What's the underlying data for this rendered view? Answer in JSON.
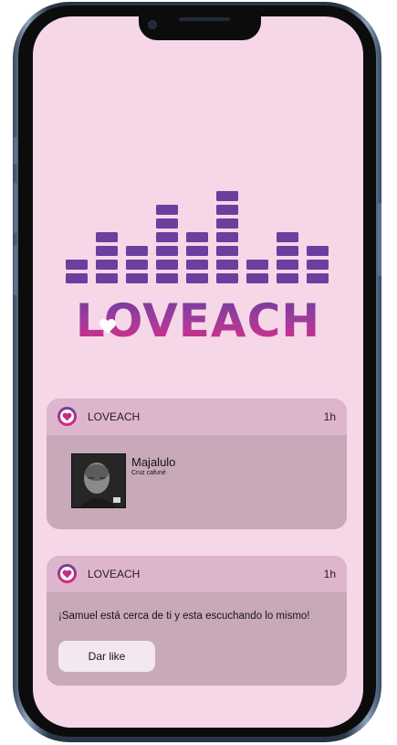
{
  "logo": {
    "text": "LOVEACH"
  },
  "notifications": [
    {
      "app_name": "LOVEACH",
      "time": "1h",
      "song_title": "Majalulo",
      "song_artist": "Cruz cafuné"
    },
    {
      "app_name": "LOVEACH",
      "time": "1h",
      "message": "¡Samuel está cerca de ti y esta escuchando lo mismo!",
      "button_label": "Dar like"
    }
  ],
  "colors": {
    "screen_bg": "#f5d7e8",
    "logo_top": "#6a3f9e",
    "logo_bottom": "#e0267e",
    "notif_header": "#ddb6ce",
    "notif_body": "#c7a9b9"
  }
}
